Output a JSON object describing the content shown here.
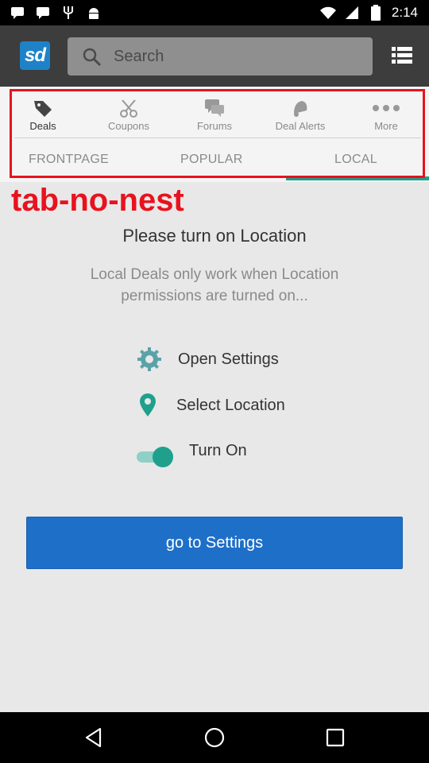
{
  "status_bar": {
    "time": "2:14",
    "left_icons": [
      "message-icon",
      "message-icon",
      "fork-icon",
      "android-icon"
    ],
    "right_icons": [
      "wifi-icon",
      "signal-icon",
      "battery-icon"
    ]
  },
  "header": {
    "logo_text": "sd",
    "search_placeholder": "Search"
  },
  "tabs": [
    {
      "label": "Deals",
      "icon": "tag-icon",
      "active": true
    },
    {
      "label": "Coupons",
      "icon": "scissors-icon",
      "active": false
    },
    {
      "label": "Forums",
      "icon": "chat-icon",
      "active": false
    },
    {
      "label": "Deal Alerts",
      "icon": "bell-icon",
      "active": false
    },
    {
      "label": "More",
      "icon": "more-dots-icon",
      "active": false
    }
  ],
  "subtabs": [
    {
      "label": "FRONTPAGE",
      "active": false
    },
    {
      "label": "POPULAR",
      "active": false
    },
    {
      "label": "LOCAL",
      "active": true
    }
  ],
  "annotation": {
    "text": "tab-no-nest",
    "color": "#e8121e"
  },
  "main": {
    "heading": "Please turn on Location",
    "subtext": "Local Deals only work when Location permissions are turned on...",
    "options": [
      {
        "label": "Open Settings",
        "icon": "gear-icon"
      },
      {
        "label": "Select Location",
        "icon": "location-pin-icon"
      },
      {
        "label": "Turn On",
        "icon": "toggle-icon"
      }
    ],
    "button_label": "go to Settings"
  },
  "colors": {
    "accent": "#1fa08c",
    "button": "#1e6fc8",
    "brand": "#1e82c8",
    "highlight": "#e8121e"
  },
  "nav_bar": {
    "icons": [
      "back-icon",
      "home-icon",
      "recents-icon"
    ]
  }
}
